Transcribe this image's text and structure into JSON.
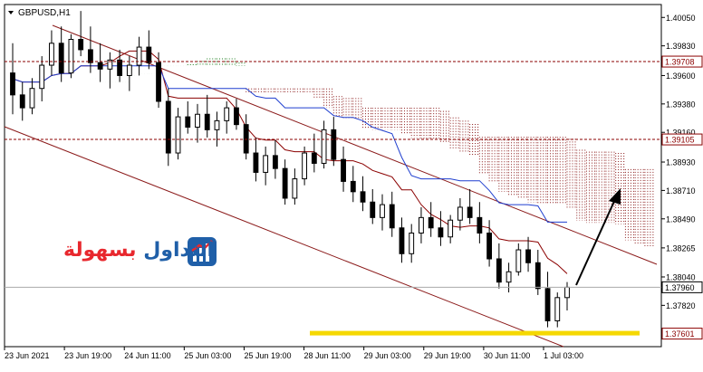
{
  "chart_data": {
    "type": "candlestick",
    "title": "GBPUSD,H1",
    "symbol": "GBPUSD",
    "timeframe": "H1",
    "ylim": [
      1.375,
      1.4015
    ],
    "y_ticks": [
      "1.40050",
      "1.39830",
      "1.39600",
      "1.39380",
      "1.39160",
      "1.38930",
      "1.38710",
      "1.38490",
      "1.38265",
      "1.38040",
      "1.37820",
      "1.37590"
    ],
    "x_ticks": [
      "23 Jun 2021",
      "23 Jun 19:00",
      "24 Jun 11:00",
      "25 Jun 03:00",
      "25 Jun 19:00",
      "28 Jun 11:00",
      "29 Jun 03:00",
      "29 Jun 19:00",
      "30 Jun 11:00",
      "1 Jul 03:00"
    ],
    "price_labels": [
      {
        "value": 1.39708,
        "text": "1.39708",
        "style": "dashed",
        "color": "#8b0000"
      },
      {
        "value": 1.39105,
        "text": "1.39105",
        "style": "dashed",
        "color": "#8b0000"
      },
      {
        "value": 1.3796,
        "text": "1.37960",
        "style": "current",
        "color": "#000000"
      },
      {
        "value": 1.37601,
        "text": "1.37601",
        "style": "support",
        "color": "#8b0000"
      }
    ],
    "candles": [
      [
        1.3962,
        1.3985,
        1.393,
        1.3945
      ],
      [
        1.3945,
        1.3955,
        1.3925,
        1.3935
      ],
      [
        1.3935,
        1.3958,
        1.393,
        1.395
      ],
      [
        1.395,
        1.3975,
        1.394,
        1.3968
      ],
      [
        1.3968,
        1.3995,
        1.396,
        1.3985
      ],
      [
        1.3985,
        1.3998,
        1.3955,
        1.3962
      ],
      [
        1.3962,
        1.3992,
        1.3958,
        1.3988
      ],
      [
        1.3988,
        1.401,
        1.3975,
        1.398
      ],
      [
        1.398,
        1.3998,
        1.3962,
        1.397
      ],
      [
        1.397,
        1.3985,
        1.3955,
        1.3965
      ],
      [
        1.3965,
        1.3978,
        1.395,
        1.3972
      ],
      [
        1.3972,
        1.398,
        1.3955,
        1.396
      ],
      [
        1.396,
        1.3975,
        1.3948,
        1.3968
      ],
      [
        1.3968,
        1.399,
        1.396,
        1.3982
      ],
      [
        1.3982,
        1.3995,
        1.3965,
        1.397
      ],
      [
        1.397,
        1.3978,
        1.3935,
        1.394
      ],
      [
        1.394,
        1.395,
        1.389,
        1.39
      ],
      [
        1.39,
        1.3935,
        1.3895,
        1.3928
      ],
      [
        1.3928,
        1.394,
        1.3915,
        1.392
      ],
      [
        1.392,
        1.3938,
        1.3908,
        1.393
      ],
      [
        1.393,
        1.3945,
        1.3912,
        1.3918
      ],
      [
        1.3918,
        1.3932,
        1.3905,
        1.3925
      ],
      [
        1.3925,
        1.394,
        1.3915,
        1.3935
      ],
      [
        1.3935,
        1.3942,
        1.3918,
        1.3922
      ],
      [
        1.3922,
        1.393,
        1.3895,
        1.39
      ],
      [
        1.39,
        1.3912,
        1.3878,
        1.3885
      ],
      [
        1.3885,
        1.3905,
        1.3875,
        1.3898
      ],
      [
        1.3898,
        1.391,
        1.388,
        1.3888
      ],
      [
        1.3888,
        1.3895,
        1.386,
        1.3865
      ],
      [
        1.3865,
        1.3888,
        1.386,
        1.388
      ],
      [
        1.388,
        1.3905,
        1.3875,
        1.39
      ],
      [
        1.39,
        1.3915,
        1.3885,
        1.3892
      ],
      [
        1.3892,
        1.3925,
        1.3888,
        1.3918
      ],
      [
        1.3918,
        1.3928,
        1.389,
        1.3895
      ],
      [
        1.3895,
        1.3905,
        1.387,
        1.3878
      ],
      [
        1.3878,
        1.389,
        1.3862,
        1.387
      ],
      [
        1.387,
        1.3882,
        1.3855,
        1.3862
      ],
      [
        1.3862,
        1.3872,
        1.3845,
        1.385
      ],
      [
        1.385,
        1.3868,
        1.384,
        1.386
      ],
      [
        1.386,
        1.387,
        1.3835,
        1.3842
      ],
      [
        1.3842,
        1.385,
        1.3815,
        1.3822
      ],
      [
        1.3822,
        1.3845,
        1.3815,
        1.3838
      ],
      [
        1.3838,
        1.3858,
        1.383,
        1.385
      ],
      [
        1.385,
        1.3862,
        1.3835,
        1.3842
      ],
      [
        1.3842,
        1.3855,
        1.3828,
        1.3835
      ],
      [
        1.3835,
        1.3852,
        1.383,
        1.3848
      ],
      [
        1.3848,
        1.3865,
        1.384,
        1.3858
      ],
      [
        1.3858,
        1.3872,
        1.3845,
        1.385
      ],
      [
        1.385,
        1.3862,
        1.383,
        1.3838
      ],
      [
        1.3838,
        1.3848,
        1.3812,
        1.3818
      ],
      [
        1.3818,
        1.383,
        1.3795,
        1.38
      ],
      [
        1.38,
        1.3815,
        1.3792,
        1.3808
      ],
      [
        1.3808,
        1.383,
        1.3805,
        1.3825
      ],
      [
        1.3825,
        1.3835,
        1.3808,
        1.3815
      ],
      [
        1.3815,
        1.3825,
        1.379,
        1.3795
      ],
      [
        1.3795,
        1.3808,
        1.3765,
        1.377
      ],
      [
        1.377,
        1.3792,
        1.3765,
        1.3788
      ],
      [
        1.3788,
        1.38,
        1.3778,
        1.3796
      ]
    ],
    "indicators": {
      "ichimoku_cloud": {
        "upper_color": "#8b1a1a",
        "lower_color": "#1a7a1a"
      },
      "tenkan_color": "#8b0000",
      "kijun_color": "#1f3fcf"
    },
    "channel": {
      "color": "#8b1a1a"
    },
    "arrow": {
      "direction": "up",
      "color": "#000000"
    },
    "support_zone": {
      "value": 1.37601,
      "color": "#f5d800"
    }
  },
  "logo": {
    "part1": "التداول",
    "part2": "بسهولة"
  }
}
